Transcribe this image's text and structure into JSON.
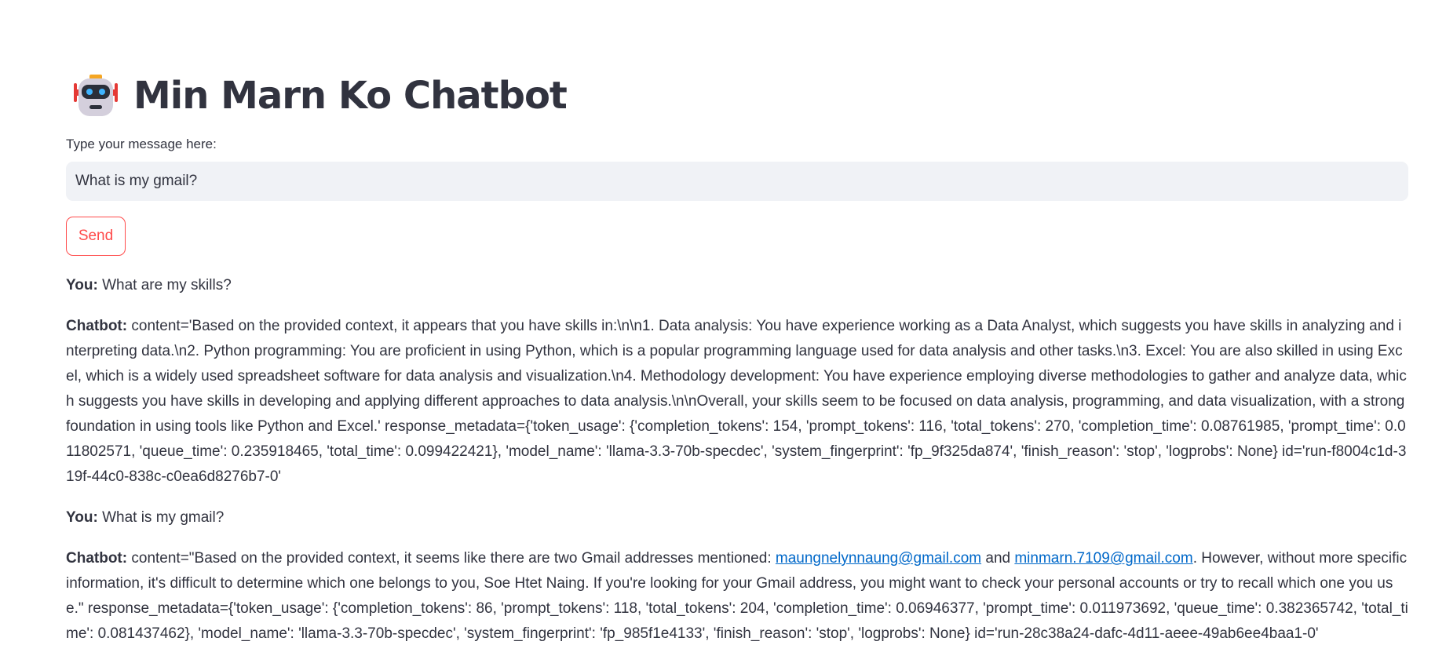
{
  "header": {
    "icon": "robot-face-icon",
    "title": "Min Marn Ko Chatbot"
  },
  "input": {
    "label": "Type your message here:",
    "value": "What is my gmail?"
  },
  "send_button": {
    "label": "Send"
  },
  "colors": {
    "accent": "#ff4b4b",
    "link": "#0068c9",
    "input_bg": "#f0f2f6",
    "text": "#31333f"
  },
  "messages": [
    {
      "speaker": "You:",
      "text": " What are my skills?"
    },
    {
      "speaker": "Chatbot:",
      "text": " content='Based on the provided context, it appears that you have skills in:\\n\\n1. Data analysis: You have experience working as a Data Analyst, which suggests you have skills in analyzing and interpreting data.\\n2. Python programming: You are proficient in using Python, which is a popular programming language used for data analysis and other tasks.\\n3. Excel: You are also skilled in using Excel, which is a widely used spreadsheet software for data analysis and visualization.\\n4. Methodology development: You have experience employing diverse methodologies to gather and analyze data, which suggests you have skills in developing and applying different approaches to data analysis.\\n\\nOverall, your skills seem to be focused on data analysis, programming, and data visualization, with a strong foundation in using tools like Python and Excel.' response_metadata={'token_usage': {'completion_tokens': 154, 'prompt_tokens': 116, 'total_tokens': 270, 'completion_time': 0.08761985, 'prompt_time': 0.011802571, 'queue_time': 0.235918465, 'total_time': 0.099422421}, 'model_name': 'llama-3.3-70b-specdec', 'system_fingerprint': 'fp_9f325da874', 'finish_reason': 'stop', 'logprobs': None} id='run-f8004c1d-319f-44c0-838c-c0ea6d8276b7-0'"
    },
    {
      "speaker": "You:",
      "text": " What is my gmail?"
    },
    {
      "speaker": "Chatbot:",
      "text_before": " content=\"Based on the provided context, it seems like there are two Gmail addresses mentioned: ",
      "link1": "maungnelynnaung@gmail.com",
      "text_between": " and ",
      "link2": "minmarn.7109@gmail.com",
      "text_after": ". However, without more specific information, it's difficult to determine which one belongs to you, Soe Htet Naing. If you're looking for your Gmail address, you might want to check your personal accounts or try to recall which one you use.\" response_metadata={'token_usage': {'completion_tokens': 86, 'prompt_tokens': 118, 'total_tokens': 204, 'completion_time': 0.06946377, 'prompt_time': 0.011973692, 'queue_time': 0.382365742, 'total_time': 0.081437462}, 'model_name': 'llama-3.3-70b-specdec', 'system_fingerprint': 'fp_985f1e4133', 'finish_reason': 'stop', 'logprobs': None} id='run-28c38a24-dafc-4d11-aeee-49ab6ee4baa1-0'"
    }
  ]
}
